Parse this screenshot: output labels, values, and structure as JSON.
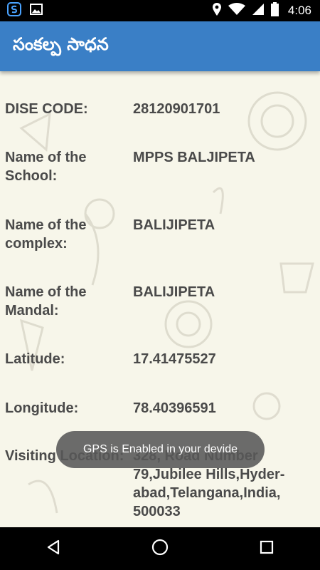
{
  "app": {
    "title": "సంకల్ప సాధన"
  },
  "status_bar": {
    "time": "4:06"
  },
  "fields": [
    {
      "label": "DISE CODE:",
      "value": "28120901701"
    },
    {
      "label": "Name of the School:",
      "value": "MPPS BALJIPETA"
    },
    {
      "label": "Name of the complex:",
      "value": "BALIJIPETA"
    },
    {
      "label": "Name of the Mandal:",
      "value": "BALIJIPETA"
    },
    {
      "label": "Latitude:",
      "value": "17.41475527"
    },
    {
      "label": "Longitude:",
      "value": "78.40396591"
    },
    {
      "label": "Visiting Location:",
      "value": "328, Road Number 79,Jubilee Hills,Hyder-abad,Telangana,India, 500033"
    }
  ],
  "toast": {
    "message": "GPS is Enabled in your devide"
  },
  "colors": {
    "app_bar": "#3a7fc6",
    "background": "#f7f6ea",
    "text": "#4a4a4a"
  },
  "icons": {
    "status_left": [
      "app-logo-icon",
      "image-notification-icon"
    ],
    "status_right": [
      "location-icon",
      "wifi-icon",
      "signal-icon",
      "battery-icon"
    ],
    "nav": [
      "back-icon",
      "home-icon",
      "recents-icon"
    ]
  }
}
